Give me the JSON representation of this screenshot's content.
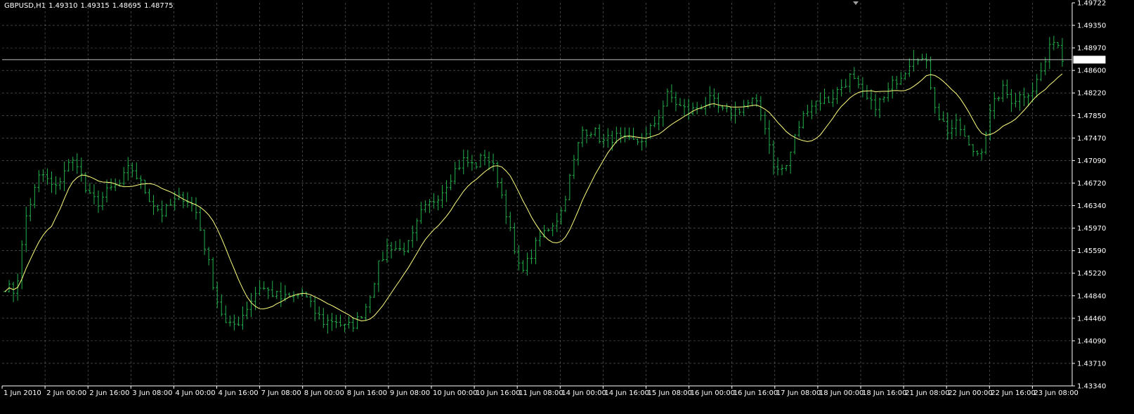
{
  "header": {
    "symbol_tf": "GBPUSD,H1",
    "open": "1.49310",
    "high": "1.49315",
    "low": "1.48695",
    "close": "1.48775"
  },
  "colors": {
    "background": "#000000",
    "grid": "#c0c0c0",
    "bar": "#22b14c",
    "ma": "#ffff80",
    "axis": "#ffffff",
    "price_line": "#c0c0c0"
  },
  "chart_data": {
    "type": "bar",
    "series_style": "ohlc-bars",
    "symbol": "GBPUSD",
    "timeframe": "H1",
    "current_price": 1.48775,
    "current_price_label": "1.48775",
    "ylim": [
      1.4334,
      1.49722
    ],
    "y_ticks": [
      "1.49722",
      "1.49350",
      "1.48970",
      "1.48600",
      "1.48220",
      "1.47850",
      "1.47470",
      "1.47090",
      "1.46720",
      "1.46340",
      "1.45970",
      "1.45590",
      "1.45220",
      "1.44840",
      "1.44460",
      "1.44090",
      "1.43710",
      "1.43340"
    ],
    "x_ticks": [
      "1 Jun 2010",
      "2 Jun 00:00",
      "2 Jun 16:00",
      "3 Jun 08:00",
      "4 Jun 00:00",
      "4 Jun 16:00",
      "7 Jun 08:00",
      "8 Jun 00:00",
      "8 Jun 16:00",
      "9 Jun 08:00",
      "10 Jun 00:00",
      "10 Jun 16:00",
      "11 Jun 08:00",
      "14 Jun 00:00",
      "14 Jun 16:00",
      "15 Jun 08:00",
      "16 Jun 00:00",
      "16 Jun 16:00",
      "17 Jun 08:00",
      "18 Jun 00:00",
      "18 Jun 16:00",
      "21 Jun 08:00",
      "22 Jun 00:00",
      "22 Jun 16:00",
      "23 Jun 08:00"
    ],
    "grid": true,
    "bar_count": 250,
    "close_path": [
      [
        0,
        1.45
      ],
      [
        3,
        1.449
      ],
      [
        6,
        1.462
      ],
      [
        10,
        1.469
      ],
      [
        14,
        1.466
      ],
      [
        17,
        1.47
      ],
      [
        20,
        1.471
      ],
      [
        23,
        1.465
      ],
      [
        26,
        1.464
      ],
      [
        29,
        1.466
      ],
      [
        32,
        1.467
      ],
      [
        35,
        1.47
      ],
      [
        38,
        1.467
      ],
      [
        41,
        1.464
      ],
      [
        44,
        1.462
      ],
      [
        47,
        1.464
      ],
      [
        50,
        1.465
      ],
      [
        53,
        1.463
      ],
      [
        56,
        1.456
      ],
      [
        59,
        1.448
      ],
      [
        62,
        1.443
      ],
      [
        65,
        1.444
      ],
      [
        68,
        1.447
      ],
      [
        71,
        1.45
      ],
      [
        74,
        1.449
      ],
      [
        77,
        1.448
      ],
      [
        80,
        1.448
      ],
      [
        83,
        1.449
      ],
      [
        86,
        1.446
      ],
      [
        89,
        1.444
      ],
      [
        92,
        1.4445
      ],
      [
        95,
        1.443
      ],
      [
        98,
        1.444
      ],
      [
        101,
        1.447
      ],
      [
        104,
        1.453
      ],
      [
        107,
        1.457
      ],
      [
        110,
        1.456
      ],
      [
        113,
        1.457
      ],
      [
        116,
        1.462
      ],
      [
        119,
        1.464
      ],
      [
        122,
        1.466
      ],
      [
        125,
        1.469
      ],
      [
        128,
        1.471
      ],
      [
        131,
        1.47
      ],
      [
        134,
        1.472
      ],
      [
        137,
        1.469
      ],
      [
        140,
        1.462
      ],
      [
        143,
        1.453
      ],
      [
        146,
        1.454
      ],
      [
        149,
        1.458
      ],
      [
        152,
        1.46
      ],
      [
        155,
        1.462
      ],
      [
        158,
        1.469
      ],
      [
        161,
        1.476
      ],
      [
        164,
        1.476
      ],
      [
        167,
        1.474
      ],
      [
        170,
        1.475
      ],
      [
        173,
        1.474
      ],
      [
        176,
        1.474
      ],
      [
        179,
        1.475
      ],
      [
        182,
        1.478
      ],
      [
        185,
        1.482
      ],
      [
        188,
        1.48
      ],
      [
        191,
        1.479
      ],
      [
        194,
        1.48
      ],
      [
        197,
        1.481
      ],
      [
        200,
        1.479
      ],
      [
        203,
        1.479
      ],
      [
        206,
        1.48
      ],
      [
        209,
        1.481
      ],
      [
        212,
        1.477
      ],
      [
        215,
        1.469
      ],
      [
        218,
        1.47
      ],
      [
        221,
        1.476
      ],
      [
        224,
        1.48
      ],
      [
        227,
        1.481
      ],
      [
        230,
        1.481
      ],
      [
        233,
        1.483
      ],
      [
        236,
        1.485
      ],
      [
        239,
        1.482
      ],
      [
        242,
        1.48
      ],
      [
        245,
        1.481
      ],
      [
        248,
        1.484
      ],
      [
        251,
        1.486
      ],
      [
        254,
        1.489
      ],
      [
        257,
        1.487
      ],
      [
        260,
        1.479
      ],
      [
        263,
        1.476
      ],
      [
        266,
        1.477
      ],
      [
        269,
        1.473
      ],
      [
        272,
        1.472
      ],
      [
        275,
        1.479
      ],
      [
        278,
        1.483
      ],
      [
        281,
        1.481
      ],
      [
        284,
        1.482
      ],
      [
        287,
        1.483
      ],
      [
        290,
        1.487
      ],
      [
        293,
        1.492
      ],
      [
        295,
        1.4878
      ]
    ]
  }
}
